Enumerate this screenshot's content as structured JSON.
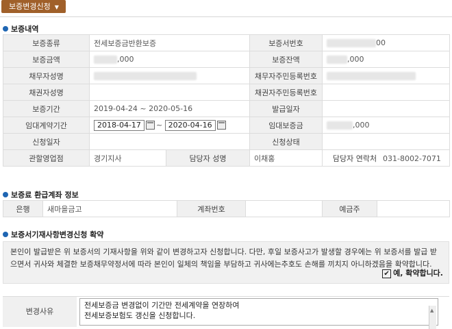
{
  "tab": {
    "label": "보증변경신청"
  },
  "section1": {
    "title": "보증내역"
  },
  "guarantee": {
    "type_label": "보증종류",
    "type_value": "전세보증금반환보증",
    "no_label": "보증서번호",
    "no_value": "00",
    "amount_label": "보증금액",
    "amount_value": ",000",
    "balance_label": "보증잔액",
    "balance_value": ",000",
    "debtor_label": "채무자성명",
    "debtor_id_label": "채무자주민등록번호",
    "creditor_label": "채권자성명",
    "creditor_id_label": "채권자주민등록번호",
    "period_label": "보증기간",
    "period_value": "2019-04-24  ~  2020-05-16",
    "issue_date_label": "발급일자",
    "lease_period_label": "임대계약기간",
    "lease_from": "2018-04-17",
    "lease_to": "2020-04-16",
    "deposit_label": "임대보증금",
    "deposit_value": ",000",
    "apply_date_label": "신청일자",
    "apply_status_label": "신청상태",
    "branch_label": "관할영업점",
    "branch_value": "경기지사",
    "manager_label": "담당자 성명",
    "manager_value": "이채홍",
    "contact_label": "담당자 연락처",
    "contact_value": "031-8002-7071"
  },
  "section2": {
    "title": "보증료 환급계좌 정보"
  },
  "refund": {
    "bank_label": "은행",
    "bank_value": "새마을금고",
    "account_label": "계좌번호",
    "holder_label": "예금주"
  },
  "section3": {
    "title": "보증서기재사항변경신청 확약"
  },
  "agreement": {
    "text": "본인이 발급받은 위 보증서의 기재사항을 위와 같이 변경하고자 신청합니다. 다만, 후일 보증사고가 발생할 경우에는 위 보증서를 발급 받으면서 귀사와   체결한 보증채무약정서에 따라 본인이 일체의 책임을 부담하고 귀사에는추호도 손해를 끼치지 아니하겠음을 확약합니다.",
    "checkbox_label": "예, 확약합니다.",
    "checked": true
  },
  "reason": {
    "label": "변경사유",
    "line1": "전세보증금 변경없이 기간만 전세계약을 연장하여",
    "line2": "전세보증보험도 갱신을 신청합니다."
  }
}
